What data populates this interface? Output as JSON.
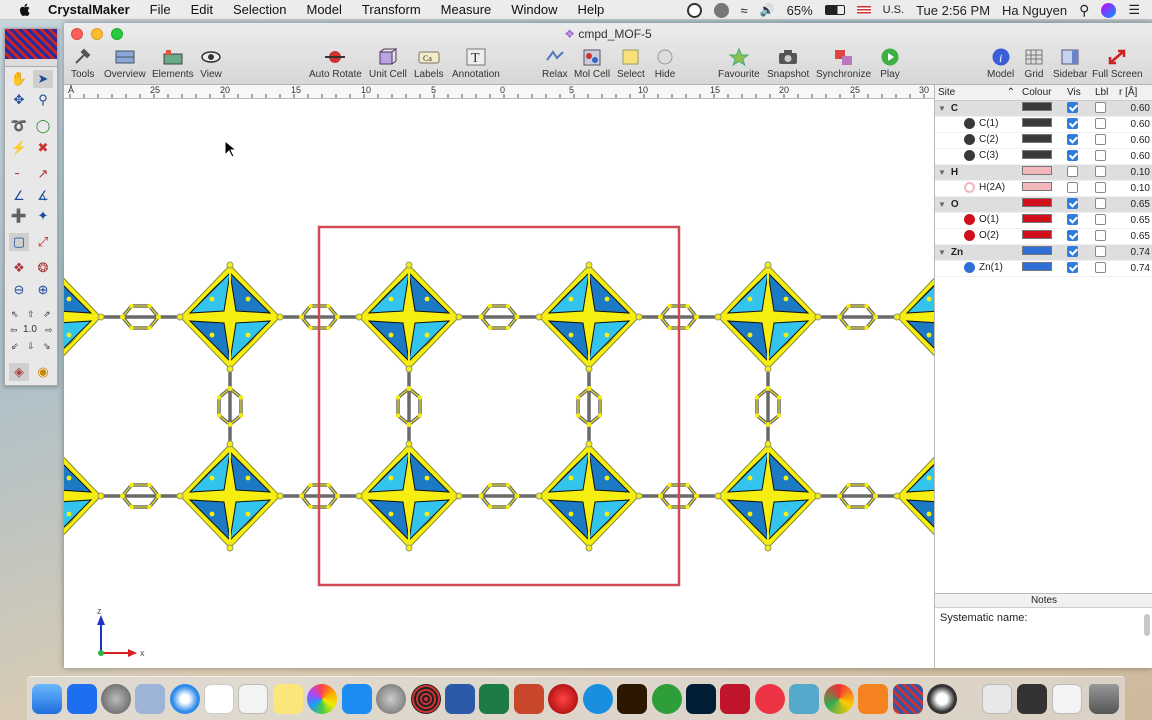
{
  "menubar": {
    "app_name": "CrystalMaker",
    "menus": [
      "File",
      "Edit",
      "Selection",
      "Model",
      "Transform",
      "Measure",
      "Window",
      "Help"
    ],
    "battery": "65%",
    "input_source": "U.S.",
    "clock": "Tue 2:56 PM",
    "user": "Ha Nguyen"
  },
  "window": {
    "title": "cmpd_MOF-5",
    "toolbar": {
      "tools": "Tools",
      "overview": "Overview",
      "elements": "Elements",
      "view": "View",
      "auto_rotate": "Auto Rotate",
      "unit_cell": "Unit Cell",
      "labels": "Labels",
      "annotation": "Annotation",
      "relax": "Relax",
      "mol_cell": "Mol Cell",
      "select": "Select",
      "hide": "Hide",
      "favourite": "Favourite",
      "snapshot": "Snapshot",
      "synchronize": "Synchronize",
      "play": "Play",
      "model": "Model",
      "grid": "Grid",
      "sidebar": "Sidebar",
      "full_screen": "Full Screen"
    },
    "ruler": [
      "Å",
      "25",
      "20",
      "15",
      "10",
      "5",
      "0",
      "5",
      "10",
      "15",
      "20",
      "25",
      "30"
    ],
    "axes": {
      "z": "z",
      "x": "x"
    }
  },
  "palette": {
    "zoom_value": "1.0"
  },
  "sidebar": {
    "headers": {
      "site": "Site",
      "colour": "Colour",
      "vis": "Vis",
      "lbl": "Lbl",
      "radius": "r [Å]"
    },
    "rows": [
      {
        "site": "C",
        "group": true,
        "color": "#3a3a3a",
        "vis": true,
        "lbl": false,
        "r": "0.60"
      },
      {
        "site": "C(1)",
        "group": false,
        "color": "#3a3a3a",
        "vis": true,
        "lbl": false,
        "r": "0.60"
      },
      {
        "site": "C(2)",
        "group": false,
        "color": "#3a3a3a",
        "vis": true,
        "lbl": false,
        "r": "0.60"
      },
      {
        "site": "C(3)",
        "group": false,
        "color": "#3a3a3a",
        "vis": true,
        "lbl": false,
        "r": "0.60"
      },
      {
        "site": "H",
        "group": true,
        "color": "#f2b8bb",
        "vis": false,
        "lbl": false,
        "r": "0.10"
      },
      {
        "site": "H(2A)",
        "group": false,
        "color": "#f2b8bb",
        "vis": false,
        "lbl": false,
        "r": "0.10"
      },
      {
        "site": "O",
        "group": true,
        "color": "#d0101c",
        "vis": true,
        "lbl": false,
        "r": "0.65"
      },
      {
        "site": "O(1)",
        "group": false,
        "color": "#d0101c",
        "vis": true,
        "lbl": false,
        "r": "0.65"
      },
      {
        "site": "O(2)",
        "group": false,
        "color": "#d0101c",
        "vis": true,
        "lbl": false,
        "r": "0.65"
      },
      {
        "site": "Zn",
        "group": true,
        "color": "#2f6fd6",
        "vis": true,
        "lbl": false,
        "r": "0.74"
      },
      {
        "site": "Zn(1)",
        "group": false,
        "color": "#2f6fd6",
        "vis": true,
        "lbl": false,
        "r": "0.74"
      }
    ],
    "notes_title": "Notes",
    "notes_text": "Systematic name:"
  },
  "colors": {
    "unit_cell": "#d04a55",
    "zn_light": "#33c4ee",
    "zn_dark": "#1c79c4",
    "o_yellow": "#f5ee10",
    "bond": "#6a6a6a"
  }
}
